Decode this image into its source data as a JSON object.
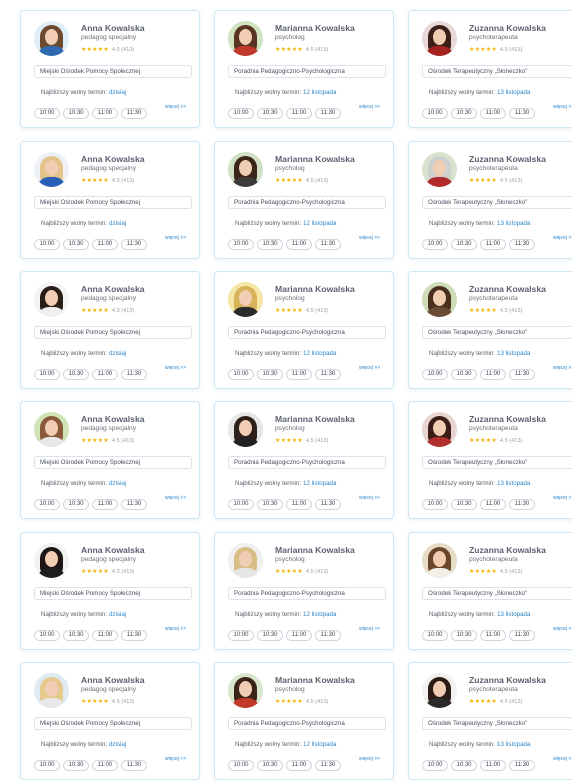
{
  "cards": [
    {
      "name": "Anna Kowalska",
      "role": "pedagog specjalny",
      "rating": "4.5 (413)",
      "place": "Miejski Ośrodek Pomocy Społecznej",
      "next_label": "Najbliższy wolny termin:",
      "next_when": "dzisiaj",
      "slots": [
        "10:00",
        "10:30",
        "11:00",
        "11:30"
      ],
      "more": "więcej >>",
      "colors": {
        "bg": "#dfeff8",
        "hair": "#6b4a2e",
        "body": "#2d6ab0"
      }
    },
    {
      "name": "Marianna Kowalska",
      "role": "psycholog",
      "rating": "4.5 (413)",
      "place": "Poradnia Pedagogiczno-Psychologiczna",
      "next_label": "Najbliższy wolny termin:",
      "next_when": "12 listopada",
      "slots": [
        "10:00",
        "10:30",
        "11:00",
        "11:30"
      ],
      "more": "więcej >>",
      "colors": {
        "bg": "#cfe3c0",
        "hair": "#5a3322",
        "body": "#c0392b"
      }
    },
    {
      "name": "Zuzanna Kowalska",
      "role": "psychoterapeuta",
      "rating": "4.5 (413)",
      "place": "Ośrodek Terapeutyczny „Słoneczko”",
      "next_label": "Najbliższy wolny termin:",
      "next_when": "13 listopada",
      "slots": [
        "10:00",
        "10:30",
        "11:00",
        "11:30"
      ],
      "more": "więcej >>",
      "colors": {
        "bg": "#e9d9d6",
        "hair": "#3b1f18",
        "body": "#a3231f"
      }
    },
    {
      "name": "Anna Kowalska",
      "role": "pedagog specjalny",
      "rating": "4.5 (413)",
      "place": "Miejski Ośrodek Pomocy Społecznej",
      "next_label": "Najbliższy wolny termin:",
      "next_when": "dzisiaj",
      "slots": [
        "10:00",
        "10:30",
        "11:00",
        "11:30"
      ],
      "more": "więcej >>",
      "colors": {
        "bg": "#eef1f6",
        "hair": "#e2c48a",
        "body": "#2a5fb8"
      }
    },
    {
      "name": "Marianna Kowalska",
      "role": "psycholog",
      "rating": "4.5 (413)",
      "place": "Poradnia Pedagogiczno-Psychologiczna",
      "next_label": "Najbliższy wolny termin:",
      "next_when": "12 listopada",
      "slots": [
        "10:00",
        "10:30",
        "11:00",
        "11:30"
      ],
      "more": "więcej >>",
      "colors": {
        "bg": "#cfe0c4",
        "hair": "#3a2618",
        "body": "#3a3a3a"
      }
    },
    {
      "name": "Zuzanna Kowalska",
      "role": "psychoterapeuta",
      "rating": "4.5 (413)",
      "place": "Ośrodek Terapeutyczny „Słoneczko”",
      "next_label": "Najbliższy wolny termin:",
      "next_when": "13 listopada",
      "slots": [
        "10:00",
        "10:30",
        "11:00",
        "11:30"
      ],
      "more": "więcej >>",
      "colors": {
        "bg": "#d8e2cc",
        "hair": "#cfcfcf",
        "body": "#b02a2a"
      }
    },
    {
      "name": "Anna Kowalska",
      "role": "pedagog specjalny",
      "rating": "4.5 (413)",
      "place": "Miejski Ośrodek Pomocy Społecznej",
      "next_label": "Najbliższy wolny termin:",
      "next_when": "dzisiaj",
      "slots": [
        "10:00",
        "10:30",
        "11:00",
        "11:30"
      ],
      "more": "więcej >>",
      "colors": {
        "bg": "#f4f4f4",
        "hair": "#2a1d18",
        "body": "#f0f0f0"
      }
    },
    {
      "name": "Marianna Kowalska",
      "role": "psycholog",
      "rating": "4.5 (413)",
      "place": "Poradnia Pedagogiczno-Psychologiczna",
      "next_label": "Najbliższy wolny termin:",
      "next_when": "12 listopada",
      "slots": [
        "10:00",
        "10:30",
        "11:00",
        "11:30"
      ],
      "more": "więcej >>",
      "colors": {
        "bg": "#f3e6a6",
        "hair": "#d8b35a",
        "body": "#2b2b2b"
      }
    },
    {
      "name": "Zuzanna Kowalska",
      "role": "psychoterapeuta",
      "rating": "4.5 (413)",
      "place": "Ośrodek Terapeutyczny „Słoneczko”",
      "next_label": "Najbliższy wolny termin:",
      "next_when": "13 listopada",
      "slots": [
        "10:00",
        "10:30",
        "11:00",
        "11:30"
      ],
      "more": "więcej >>",
      "colors": {
        "bg": "#cfdcb8",
        "hair": "#4a2f1f",
        "body": "#6a4b35"
      }
    },
    {
      "name": "Anna Kowalska",
      "role": "pedagog specjalny",
      "rating": "4.5 (413)",
      "place": "Miejski Ośrodek Pomocy Społecznej",
      "next_label": "Najbliższy wolny termin:",
      "next_when": "dzisiaj",
      "slots": [
        "10:00",
        "10:30",
        "11:00",
        "11:30"
      ],
      "more": "więcej >>",
      "colors": {
        "bg": "#cfe3b5",
        "hair": "#8a5a3a",
        "body": "#e8e8e8"
      }
    },
    {
      "name": "Marianna Kowalska",
      "role": "psycholog",
      "rating": "4.5 (413)",
      "place": "Poradnia Pedagogiczno-Psychologiczna",
      "next_label": "Najbliższy wolny termin:",
      "next_when": "12 listopada",
      "slots": [
        "10:00",
        "10:30",
        "11:00",
        "11:30"
      ],
      "more": "więcej >>",
      "colors": {
        "bg": "#e6e6e6",
        "hair": "#2d1f1a",
        "body": "#222222"
      }
    },
    {
      "name": "Zuzanna Kowalska",
      "role": "psychoterapeuta",
      "rating": "4.5 (413)",
      "place": "Ośrodek Terapeutyczny „Słoneczko”",
      "next_label": "Najbliższy wolny termin:",
      "next_when": "13 listopada",
      "slots": [
        "10:00",
        "10:30",
        "11:00",
        "11:30"
      ],
      "more": "więcej >>",
      "colors": {
        "bg": "#e8d4d0",
        "hair": "#3a1d16",
        "body": "#b0302c"
      }
    },
    {
      "name": "Anna Kowalska",
      "role": "pedagog specjalny",
      "rating": "4.5 (413)",
      "place": "Miejski Ośrodek Pomocy Społecznej",
      "next_label": "Najbliższy wolny termin:",
      "next_when": "dzisiaj",
      "slots": [
        "10:00",
        "10:30",
        "11:00",
        "11:30"
      ],
      "more": "więcej >>",
      "colors": {
        "bg": "#f2f2f2",
        "hair": "#1e1614",
        "body": "#1e1e1e"
      }
    },
    {
      "name": "Marianna Kowalska",
      "role": "psycholog",
      "rating": "4.5 (413)",
      "place": "Poradnia Pedagogiczno-Psychologiczna",
      "next_label": "Najbliższy wolny termin:",
      "next_when": "12 listopada",
      "slots": [
        "10:00",
        "10:30",
        "11:00",
        "11:30"
      ],
      "more": "więcej >>",
      "colors": {
        "bg": "#efefef",
        "hair": "#d8bd86",
        "body": "#e6e6e6"
      }
    },
    {
      "name": "Zuzanna Kowalska",
      "role": "psychoterapeuta",
      "rating": "4.5 (413)",
      "place": "Ośrodek Terapeutyczny „Słoneczko”",
      "next_label": "Najbliższy wolny termin:",
      "next_when": "13 listopada",
      "slots": [
        "10:00",
        "10:30",
        "11:00",
        "11:30"
      ],
      "more": "więcej >>",
      "colors": {
        "bg": "#e6dcc8",
        "hair": "#6a4628",
        "body": "#f0efe8"
      }
    },
    {
      "name": "Anna Kowalska",
      "role": "pedagog specjalny",
      "rating": "4.5 (413)",
      "place": "Miejski Ośrodek Pomocy Społecznej",
      "next_label": "Najbliższy wolny termin:",
      "next_when": "dzisiaj",
      "slots": [
        "10:00",
        "10:30",
        "11:00",
        "11:30"
      ],
      "more": "więcej >>",
      "colors": {
        "bg": "#dfeaf2",
        "hair": "#e6c98c",
        "body": "#e8e8e8"
      }
    },
    {
      "name": "Marianna Kowalska",
      "role": "psycholog",
      "rating": "4.5 (413)",
      "place": "Poradnia Pedagogiczno-Psychologiczna",
      "next_label": "Najbliższy wolny termin:",
      "next_when": "12 listopada",
      "slots": [
        "10:00",
        "10:30",
        "11:00",
        "11:30"
      ],
      "more": "więcej >>",
      "colors": {
        "bg": "#d8e6cc",
        "hair": "#3a2418",
        "body": "#c0392b"
      }
    },
    {
      "name": "Zuzanna Kowalska",
      "role": "psychoterapeuta",
      "rating": "4.5 (413)",
      "place": "Ośrodek Terapeutyczny „Słoneczko”",
      "next_label": "Najbliższy wolny termin:",
      "next_when": "13 listopada",
      "slots": [
        "10:00",
        "10:30",
        "11:00",
        "11:30"
      ],
      "more": "więcej >>",
      "colors": {
        "bg": "#f2f2f2",
        "hair": "#2c1c16",
        "body": "#2a2a2a"
      }
    }
  ]
}
